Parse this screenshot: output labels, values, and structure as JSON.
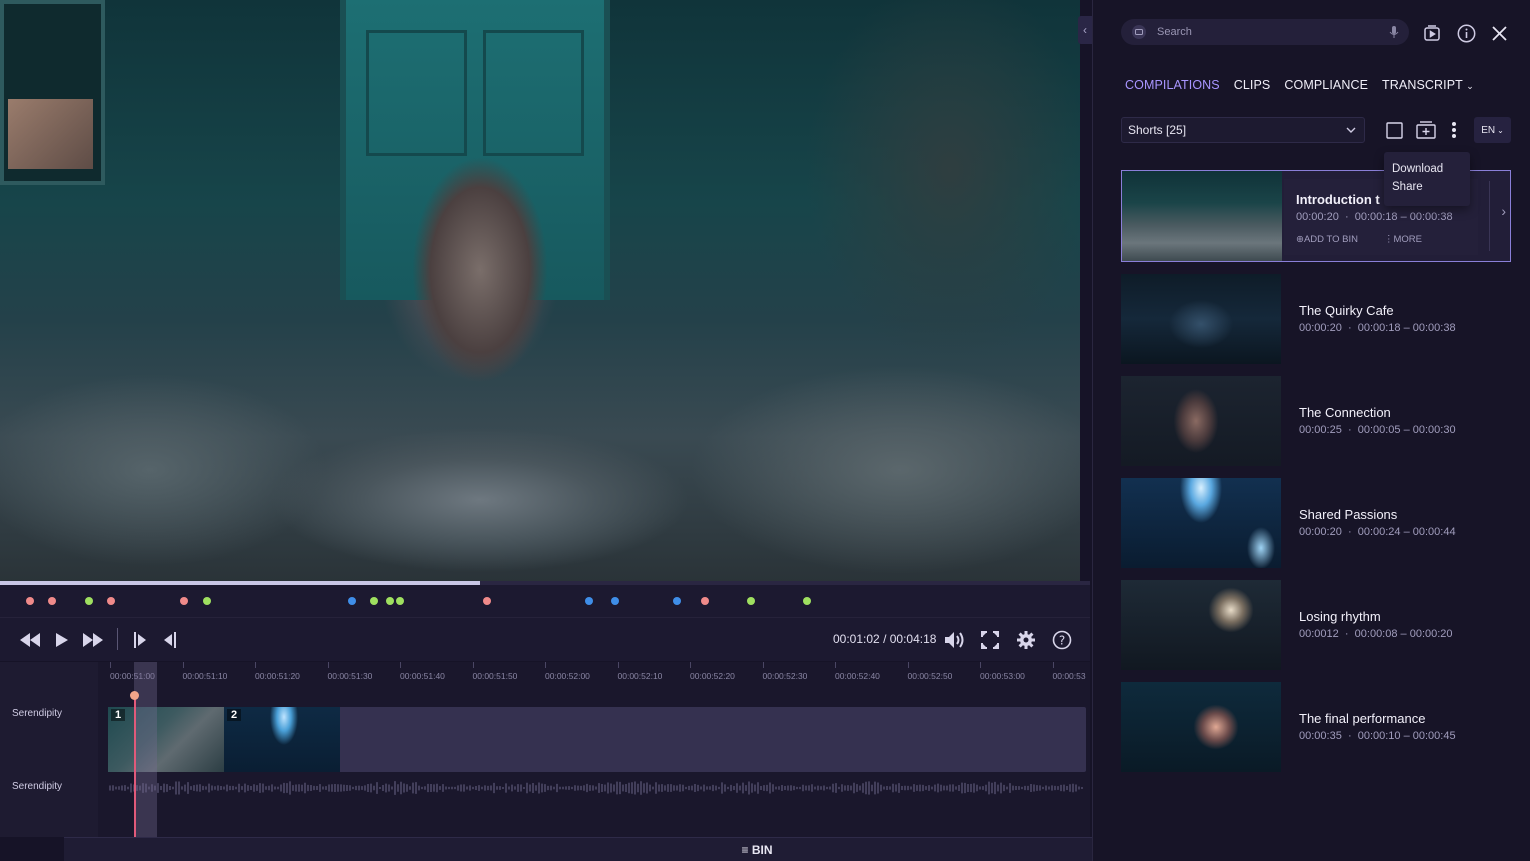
{
  "player": {
    "current_time": "00:01:02",
    "duration": "00:04:18",
    "time_separator": "/",
    "progress": 0.44,
    "markers": [
      {
        "pos": 0.024,
        "color": "#f08a8a"
      },
      {
        "pos": 0.044,
        "color": "#f08a8a"
      },
      {
        "pos": 0.078,
        "color": "#9fe060"
      },
      {
        "pos": 0.098,
        "color": "#f08a8a"
      },
      {
        "pos": 0.165,
        "color": "#f08a8a"
      },
      {
        "pos": 0.186,
        "color": "#9fe060"
      },
      {
        "pos": 0.319,
        "color": "#3f8ee8"
      },
      {
        "pos": 0.339,
        "color": "#9fe060"
      },
      {
        "pos": 0.354,
        "color": "#9fe060"
      },
      {
        "pos": 0.363,
        "color": "#9fe060"
      },
      {
        "pos": 0.443,
        "color": "#f08a8a"
      },
      {
        "pos": 0.537,
        "color": "#3f8ee8"
      },
      {
        "pos": 0.561,
        "color": "#3f8ee8"
      },
      {
        "pos": 0.617,
        "color": "#3f8ee8"
      },
      {
        "pos": 0.643,
        "color": "#f08a8a"
      },
      {
        "pos": 0.685,
        "color": "#9fe060"
      },
      {
        "pos": 0.737,
        "color": "#9fe060"
      }
    ]
  },
  "timeline": {
    "ticks": [
      "00:00:51:00",
      "00:00:51:10",
      "00:00:51:20",
      "00:00:51:30",
      "00:00:51:40",
      "00:00:51:50",
      "00:00:52:00",
      "00:00:52:10",
      "00:00:52:20",
      "00:00:52:30",
      "00:00:52:40",
      "00:00:52:50",
      "00:00:53:00",
      "00:00:53"
    ],
    "tracks": [
      "Serendipity",
      "Serendipity"
    ],
    "clips": [
      {
        "num": "1"
      },
      {
        "num": "2"
      }
    ]
  },
  "bin_label": "≡ BIN",
  "panel": {
    "search_placeholder": "Search",
    "tabs": [
      "COMPLIANCE",
      "CLIPS",
      "COMPILATIONS",
      "TRANSCRIPT"
    ],
    "tab_labels": {
      "compilations": "COMPILATIONS",
      "clips": "CLIPS",
      "compliance": "COMPLIANCE",
      "transcript": "TRANSCRIPT"
    },
    "select_value": "Shorts [25]",
    "language": "EN",
    "menu": {
      "download": "Download",
      "share": "Share"
    },
    "actions": {
      "add_to_bin": "ADD TO BIN",
      "more": "MORE"
    },
    "items": [
      {
        "title": "Introduction t",
        "duration": "00:00:20",
        "range": "00:00:18 – 00:00:38"
      },
      {
        "title": "The Quirky Cafe",
        "duration": "00:00:20",
        "range": "00:00:18 – 00:00:38"
      },
      {
        "title": "The Connection",
        "duration": "00:00:25",
        "range": "00:00:05 – 00:00:30"
      },
      {
        "title": "Shared Passions",
        "duration": "00:00:20",
        "range": "00:00:24 – 00:00:44"
      },
      {
        "title": "Losing rhythm",
        "duration": "00:0012",
        "range": "00:00:08 – 00:00:20"
      },
      {
        "title": "The final performance",
        "duration": "00:00:35",
        "range": "00:00:10 – 00:00:45"
      }
    ]
  },
  "colors": {
    "accent": "#a895ff",
    "playhead": "#e05a7a",
    "panel_bg": "#171427"
  }
}
